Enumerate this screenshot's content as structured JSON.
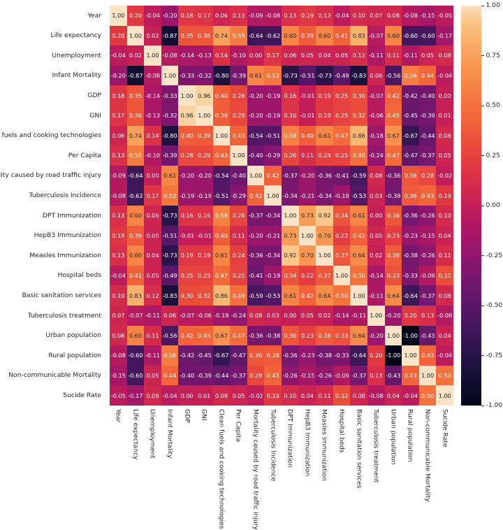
{
  "chart_data": {
    "type": "heatmap",
    "title": "",
    "xlabel": "",
    "ylabel": "",
    "grid": false,
    "legend_position": "right",
    "colormap": "rocket",
    "value_range": [
      -1.0,
      1.0
    ],
    "colorbar": {
      "ticks": [
        "1.00",
        "0.75",
        "0.50",
        "0.25",
        "0.00",
        "-0.25",
        "-0.50",
        "-0.75",
        "-1.00"
      ],
      "tick_values": [
        1.0,
        0.75,
        0.5,
        0.25,
        0.0,
        -0.25,
        -0.5,
        -0.75,
        -1.0
      ],
      "vmin": -1.0,
      "vmax": 1.0
    },
    "categories": [
      "Year",
      "Life expectancy",
      "Unemployment",
      "Infant Mortality",
      "GDP",
      "GNI",
      "Clean fuels and cooking technologies",
      "Per Capita",
      "Mortality caused by road traffic injury",
      "Tuberculosis Incidence",
      "DPT Immunization",
      "HepB3 Immunization",
      "Measles Immunization",
      "Hospital beds",
      "Basic sanitation services",
      "Tuberculosis treatment",
      "Urban population",
      "Rural population",
      "Non-communicable Mortality",
      "Sucide Rate"
    ],
    "rows": [
      "Year",
      "Life expectancy",
      "Unemployment",
      "Infant Mortality",
      "GDP",
      "GNI",
      "Clean fuels and cooking technologies",
      "Per Capita",
      "Mortality caused by road traffic injury",
      "Tuberculosis Incidence",
      "DPT Immunization",
      "HepB3 Immunization",
      "Measles Immunization",
      "Hospital beds",
      "Basic sanitation services",
      "Tuberculosis treatment",
      "Urban population",
      "Rural population",
      "Non-communicable Mortality",
      "Sucide Rate"
    ],
    "values": [
      [
        1.0,
        0.2,
        -0.04,
        -0.2,
        0.18,
        0.17,
        0.06,
        0.13,
        -0.09,
        -0.08,
        0.13,
        0.19,
        0.13,
        -0.04,
        0.1,
        0.07,
        0.08,
        -0.08,
        -0.15,
        -0.05
      ],
      [
        0.2,
        1.0,
        0.02,
        -0.87,
        0.35,
        0.36,
        0.74,
        0.55,
        -0.64,
        -0.62,
        0.6,
        0.39,
        0.6,
        0.41,
        0.83,
        -0.07,
        0.6,
        -0.6,
        -0.6,
        -0.17
      ],
      [
        -0.04,
        0.02,
        1.0,
        -0.08,
        -0.14,
        -0.13,
        0.14,
        -0.1,
        0.0,
        0.17,
        0.06,
        0.05,
        0.04,
        0.05,
        0.12,
        -0.11,
        0.11,
        -0.11,
        0.05,
        0.08
      ],
      [
        -0.2,
        -0.87,
        -0.08,
        1.0,
        -0.33,
        -0.32,
        -0.8,
        -0.39,
        0.61,
        0.52,
        -0.73,
        -0.51,
        -0.73,
        -0.49,
        -0.83,
        0.06,
        -0.56,
        0.56,
        0.44,
        -0.04
      ],
      [
        0.18,
        0.35,
        -0.14,
        -0.33,
        1.0,
        0.96,
        0.4,
        0.28,
        -0.2,
        -0.19,
        0.16,
        -0.01,
        0.19,
        0.25,
        0.3,
        -0.07,
        0.42,
        -0.42,
        -0.4,
        0.0
      ],
      [
        0.17,
        0.36,
        -0.13,
        -0.32,
        0.96,
        1.0,
        0.39,
        0.29,
        -0.2,
        -0.19,
        0.16,
        -0.01,
        0.19,
        0.25,
        0.32,
        -0.06,
        0.45,
        -0.45,
        -0.39,
        0.01
      ],
      [
        0.06,
        0.74,
        0.14,
        -0.8,
        0.4,
        0.39,
        1.0,
        0.43,
        -0.54,
        -0.51,
        0.58,
        0.4,
        0.61,
        0.47,
        0.86,
        -0.18,
        0.67,
        -0.67,
        -0.44,
        0.08
      ],
      [
        0.13,
        0.55,
        -0.1,
        -0.39,
        0.28,
        0.29,
        0.43,
        1.0,
        -0.4,
        -0.29,
        0.26,
        0.11,
        0.24,
        0.25,
        0.49,
        -0.24,
        0.47,
        -0.47,
        -0.37,
        0.05
      ],
      [
        -0.09,
        -0.64,
        0.0,
        0.61,
        -0.2,
        -0.2,
        -0.54,
        -0.4,
        1.0,
        0.42,
        -0.37,
        -0.2,
        -0.36,
        -0.41,
        -0.59,
        0.08,
        -0.36,
        0.36,
        0.28,
        -0.02
      ],
      [
        -0.08,
        -0.62,
        0.17,
        0.52,
        -0.19,
        -0.19,
        -0.51,
        -0.29,
        0.42,
        1.0,
        -0.34,
        -0.21,
        -0.34,
        -0.19,
        -0.53,
        0.03,
        -0.38,
        0.38,
        0.43,
        0.19
      ],
      [
        0.13,
        0.6,
        0.06,
        -0.73,
        0.16,
        0.16,
        0.58,
        0.26,
        -0.37,
        -0.34,
        1.0,
        0.73,
        0.92,
        0.34,
        0.61,
        0.0,
        0.36,
        -0.36,
        -0.26,
        0.1
      ],
      [
        0.19,
        0.39,
        0.05,
        -0.51,
        -0.01,
        -0.01,
        0.4,
        0.11,
        -0.2,
        -0.21,
        0.73,
        1.0,
        0.7,
        0.22,
        0.42,
        0.05,
        0.23,
        -0.23,
        -0.15,
        0.04
      ],
      [
        0.13,
        0.6,
        0.04,
        -0.73,
        0.19,
        0.19,
        0.61,
        0.24,
        -0.36,
        -0.34,
        0.92,
        0.7,
        1.0,
        0.37,
        0.64,
        0.02,
        0.38,
        -0.38,
        -0.26,
        0.11
      ],
      [
        -0.04,
        0.41,
        0.05,
        -0.49,
        0.25,
        0.25,
        0.47,
        0.25,
        -0.41,
        -0.19,
        0.34,
        0.22,
        0.37,
        1.0,
        0.5,
        -0.14,
        0.33,
        -0.33,
        -0.09,
        0.32
      ],
      [
        0.1,
        0.83,
        0.12,
        -0.83,
        0.3,
        0.32,
        0.86,
        0.49,
        -0.59,
        -0.53,
        0.61,
        0.42,
        0.64,
        0.5,
        1.0,
        -0.11,
        0.64,
        -0.64,
        -0.37,
        0.08
      ],
      [
        0.07,
        -0.07,
        -0.11,
        0.06,
        -0.07,
        -0.06,
        -0.18,
        -0.24,
        0.08,
        0.03,
        0.0,
        0.05,
        0.02,
        -0.14,
        -0.11,
        1.0,
        -0.2,
        0.2,
        0.13,
        -0.08
      ],
      [
        0.08,
        0.6,
        0.11,
        -0.56,
        0.42,
        0.45,
        0.67,
        0.47,
        -0.36,
        -0.38,
        0.36,
        0.23,
        0.38,
        0.33,
        0.64,
        -0.2,
        1.0,
        -1.0,
        -0.43,
        0.04
      ],
      [
        -0.08,
        -0.6,
        -0.11,
        0.56,
        -0.42,
        -0.45,
        -0.67,
        -0.47,
        0.36,
        0.38,
        -0.36,
        -0.23,
        -0.38,
        -0.33,
        -0.64,
        0.2,
        -1.0,
        1.0,
        0.43,
        -0.04
      ],
      [
        -0.15,
        -0.6,
        0.05,
        0.44,
        -0.4,
        -0.39,
        -0.44,
        -0.37,
        0.28,
        0.43,
        -0.26,
        -0.15,
        -0.26,
        -0.09,
        -0.37,
        0.13,
        -0.43,
        0.43,
        1.0,
        0.5
      ],
      [
        -0.05,
        -0.17,
        0.08,
        -0.04,
        0.0,
        0.01,
        0.08,
        0.05,
        -0.02,
        0.19,
        0.1,
        0.04,
        0.11,
        0.32,
        0.08,
        -0.08,
        0.04,
        -0.04,
        0.5,
        1.0
      ]
    ]
  }
}
